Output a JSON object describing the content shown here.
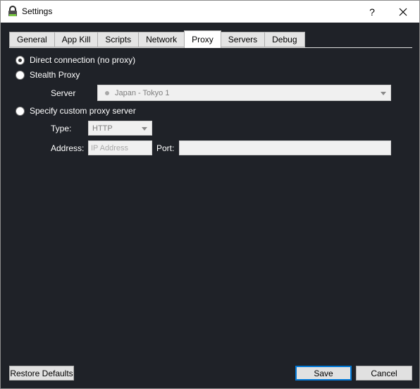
{
  "window": {
    "title": "Settings",
    "help_label": "?",
    "close_label": "✕"
  },
  "tabs": [
    {
      "label": "General"
    },
    {
      "label": "App Kill"
    },
    {
      "label": "Scripts"
    },
    {
      "label": "Network"
    },
    {
      "label": "Proxy",
      "active": true
    },
    {
      "label": "Servers"
    },
    {
      "label": "Debug"
    }
  ],
  "proxy": {
    "direct_label": "Direct connection (no proxy)",
    "stealth_label": "Stealth Proxy",
    "server_label": "Server",
    "server_value": "Japan - Tokyo 1",
    "custom_label": "Specify custom proxy server",
    "type_label": "Type:",
    "type_value": "HTTP",
    "address_label": "Address:",
    "address_placeholder": "IP Address",
    "port_label": "Port:",
    "port_value": "",
    "selected": "direct"
  },
  "footer": {
    "restore_label": "Restore Defaults",
    "save_label": "Save",
    "cancel_label": "Cancel"
  },
  "colors": {
    "panel_background": "#1f2228",
    "accent": "#0078d7"
  }
}
